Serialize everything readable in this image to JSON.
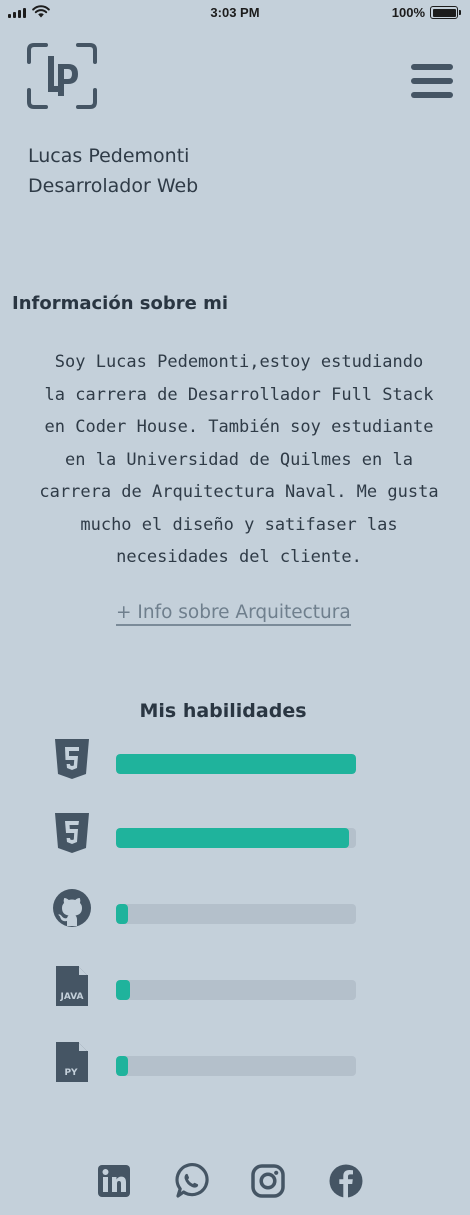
{
  "status_bar": {
    "time": "3:03 PM",
    "battery": "100%",
    "icons": [
      "signal-icon",
      "wifi-icon",
      "battery-icon"
    ]
  },
  "header": {
    "logo_icon": "lp-logo-icon",
    "menu_icon": "hamburger-menu-icon",
    "name": "Lucas Pedemonti",
    "role": "Desarrolador Web"
  },
  "about": {
    "heading": "Información sobre mi",
    "paragraph": "Soy Lucas Pedemonti,estoy estudiando\nla carrera de Desarrollador Full Stack\nen Coder House. También soy estudiante\nen la Universidad de Quilmes en la\ncarrera de Arquitectura Naval. Me gusta\nmucho el diseño y satifaser las\nnecesidades del cliente.",
    "link_label": "+ Info sobre Arquitectura"
  },
  "skills": {
    "heading": "Mis habilidades",
    "items": [
      {
        "icon": "html5-icon",
        "level": 1.0
      },
      {
        "icon": "css3-icon",
        "level": 0.97
      },
      {
        "icon": "github-icon",
        "level": 0.05
      },
      {
        "icon": "java-file-icon",
        "level": 0.06
      },
      {
        "icon": "python-file-icon",
        "level": 0.05
      }
    ]
  },
  "social": [
    "linkedin-icon",
    "whatsapp-icon",
    "instagram-icon",
    "facebook-icon"
  ],
  "colors": {
    "background": "#c4d0da",
    "skill_fill": "#1fb39c",
    "skill_track": "#b4c0cb",
    "icon": "#455564"
  }
}
